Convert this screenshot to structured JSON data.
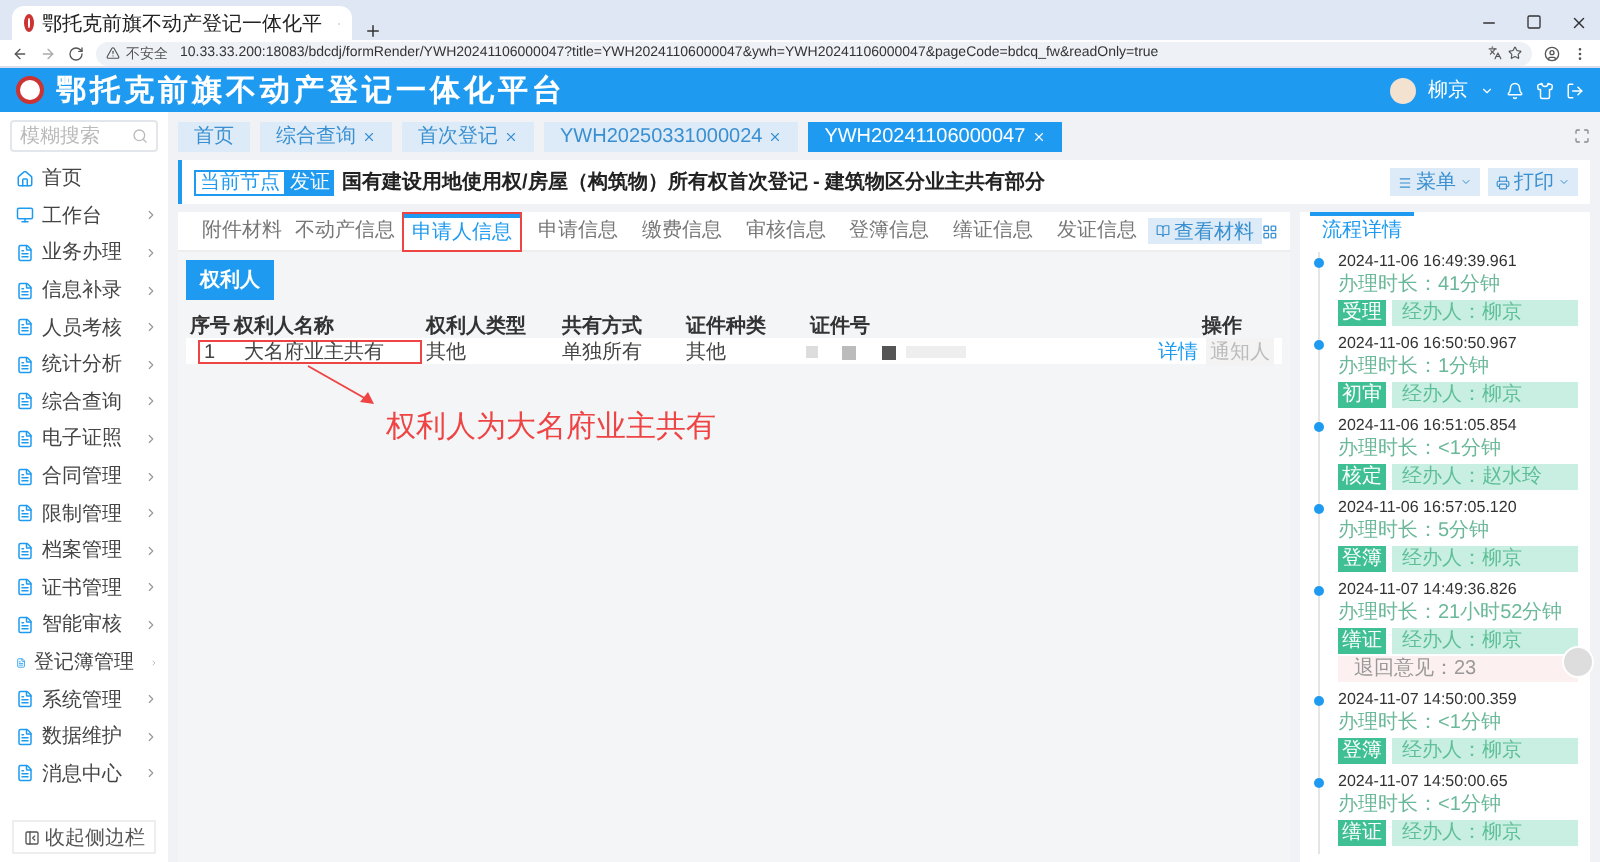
{
  "browser": {
    "tab_title": "鄂托克前旗不动产登记一体化平",
    "security_label": "不安全",
    "url": "10.33.33.200:18083/bdcdj/formRender/YWH20241106000047?title=YWH20241106000047&ywh=YWH20241106000047&pageCode=bdcq_fw&readOnly=true"
  },
  "header": {
    "title": "鄂托克前旗不动产登记一体化平台",
    "user": "柳京"
  },
  "sidebar": {
    "search_placeholder": "模糊搜索",
    "items": [
      {
        "label": "首页",
        "expandable": false
      },
      {
        "label": "工作台",
        "expandable": true
      },
      {
        "label": "业务办理",
        "expandable": true
      },
      {
        "label": "信息补录",
        "expandable": true
      },
      {
        "label": "人员考核",
        "expandable": true
      },
      {
        "label": "统计分析",
        "expandable": true
      },
      {
        "label": "综合查询",
        "expandable": true
      },
      {
        "label": "电子证照",
        "expandable": true
      },
      {
        "label": "合同管理",
        "expandable": true
      },
      {
        "label": "限制管理",
        "expandable": true
      },
      {
        "label": "档案管理",
        "expandable": true
      },
      {
        "label": "证书管理",
        "expandable": true
      },
      {
        "label": "智能审核",
        "expandable": true
      },
      {
        "label": "登记簿管理",
        "expandable": true
      },
      {
        "label": "系统管理",
        "expandable": true
      },
      {
        "label": "数据维护",
        "expandable": true
      },
      {
        "label": "消息中心",
        "expandable": true
      }
    ],
    "collapse_label": "收起侧边栏"
  },
  "page_tabs": [
    {
      "label": "首页",
      "selected": false,
      "closable": false
    },
    {
      "label": "综合查询",
      "selected": false,
      "closable": true
    },
    {
      "label": "首次登记",
      "selected": false,
      "closable": true
    },
    {
      "label": "YWH20250331000024",
      "selected": false,
      "closable": true
    },
    {
      "label": "YWH20241106000047",
      "selected": true,
      "closable": true
    }
  ],
  "node": {
    "label": "当前节点",
    "value": "发证"
  },
  "title": "国有建设用地使用权/房屋（构筑物）所有权首次登记 - 建筑物区分业主共有部分",
  "actions": [
    "菜单",
    "打印"
  ],
  "info_tabs": [
    {
      "label": "附件材料",
      "selected": false
    },
    {
      "label": "不动产信息",
      "selected": false
    },
    {
      "label": "申请人信息",
      "selected": true
    },
    {
      "label": "申请信息",
      "selected": false
    },
    {
      "label": "缴费信息",
      "selected": false
    },
    {
      "label": "审核信息",
      "selected": false
    },
    {
      "label": "登簿信息",
      "selected": false
    },
    {
      "label": "缮证信息",
      "selected": false
    },
    {
      "label": "发证信息",
      "selected": false
    }
  ],
  "view_button": "查看材料",
  "sub_tab": "权利人",
  "table": {
    "columns": [
      "序号",
      "权利人名称",
      "权利人类型",
      "共有方式",
      "证件种类",
      "证件号",
      "操作"
    ],
    "rows": [
      {
        "cells": [
          "1",
          "大名府业主共有",
          "其他",
          "单独所有",
          "其他"
        ],
        "actions": [
          {
            "label": "详情",
            "disabled": false
          },
          {
            "label": "通知人",
            "disabled": true
          }
        ]
      }
    ]
  },
  "annotation": "权利人为大名府业主共有",
  "process": {
    "title": "流程详情",
    "entries": [
      {
        "time": "2024-11-06 16:49:39.961",
        "duration": "办理时长：41分钟",
        "step": "受理",
        "handler": "经办人：柳京"
      },
      {
        "time": "2024-11-06 16:50:50.967",
        "duration": "办理时长：1分钟",
        "step": "初审",
        "handler": "经办人：柳京"
      },
      {
        "time": "2024-11-06 16:51:05.854",
        "duration": "办理时长：<1分钟",
        "step": "核定",
        "handler": "经办人：赵水玲"
      },
      {
        "time": "2024-11-06 16:57:05.120",
        "duration": "办理时长：5分钟",
        "step": "登簿",
        "handler": "经办人：柳京"
      },
      {
        "time": "2024-11-07 14:49:36.826",
        "duration": "办理时长：21小时52分钟",
        "step": "缮证",
        "handler": "经办人：柳京",
        "note": "退回意见：23"
      },
      {
        "time": "2024-11-07 14:50:00.359",
        "duration": "办理时长：<1分钟",
        "step": "登簿",
        "handler": "经办人：柳京"
      },
      {
        "time": "2024-11-07 14:50:00.65",
        "duration": "办理时长：<1分钟",
        "step": "缮证",
        "handler": "经办人：柳京"
      }
    ]
  }
}
